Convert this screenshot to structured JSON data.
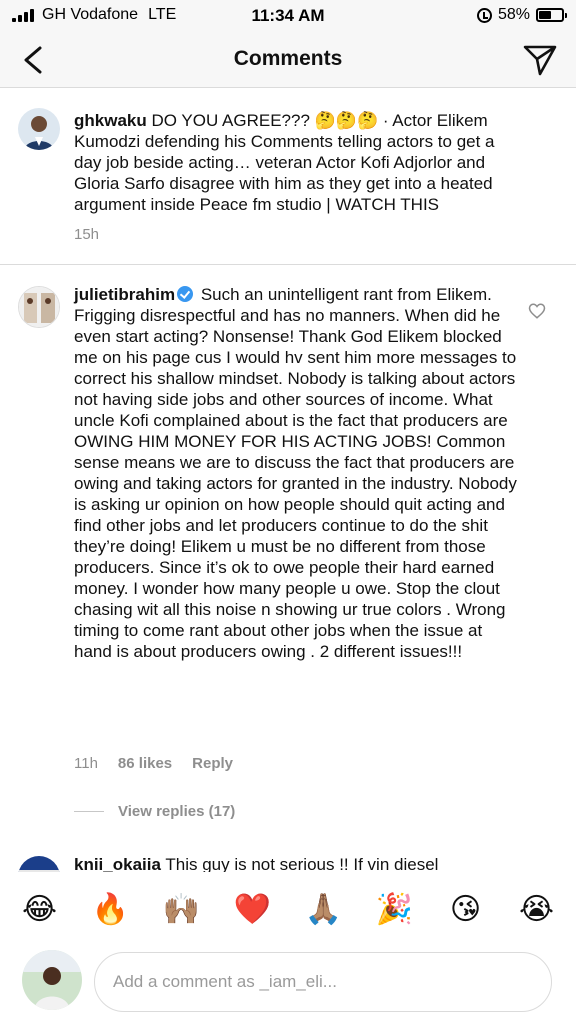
{
  "status_bar": {
    "carrier": "GH Vodafone",
    "network": "LTE",
    "time": "11:34 AM",
    "battery": "58%",
    "battery_level": 0.58
  },
  "header": {
    "title": "Comments"
  },
  "caption": {
    "username": "ghkwaku",
    "text": "DO YOU AGREE??? 🤔🤔🤔 · Actor Elikem Kumodzi defending his Comments telling actors to get a day job beside acting… veteran Actor Kofi Adjorlor and Gloria Sarfo disagree with him as they get into a heated argument inside Peace fm studio | WATCH THIS",
    "time": "15h"
  },
  "comment": {
    "username": "julietibrahim",
    "text": "Such an unintelligent rant from Elikem. Frigging disrespectful and has no manners. When did he even start acting? Nonsense! Thank God Elikem blocked me on his page cus I would hv sent him more messages to correct his shallow mindset. Nobody is talking about actors not having side jobs and other sources of income. What uncle Kofi complained about is the fact that producers are OWING HIM MONEY FOR HIS ACTING JOBS! Common sense means we are to discuss the fact that producers are owing and taking actors for granted in the industry. Nobody is asking ur opinion on how people should quit acting and find other jobs and let producers continue to do the shit they’re doing! Elikem u must be no different from those producers. Since it’s ok to owe people their hard earned money. I wonder how many people u owe. Stop the clout chasing wit all this noise n showing ur true colors . Wrong timing to come rant about other jobs when the issue at hand is about producers owing . 2 different issues!!!",
    "time": "11h",
    "likes": "86 likes",
    "reply": "Reply",
    "view_replies": "View replies (17)"
  },
  "next_comment": {
    "username": "knii_okaiia",
    "text": "This guy is not serious !! If vin diesel"
  },
  "emoji_bar": [
    "😂",
    "🔥",
    "🙌🏽",
    "❤️",
    "🙏🏽",
    "🎉",
    "😘",
    "😭"
  ],
  "composer": {
    "placeholder": "Add a comment as _iam_eli..."
  },
  "colors": {
    "verified": "#3897f0",
    "meta_text": "#8e8e8e",
    "divider": "#dbdbdb"
  }
}
